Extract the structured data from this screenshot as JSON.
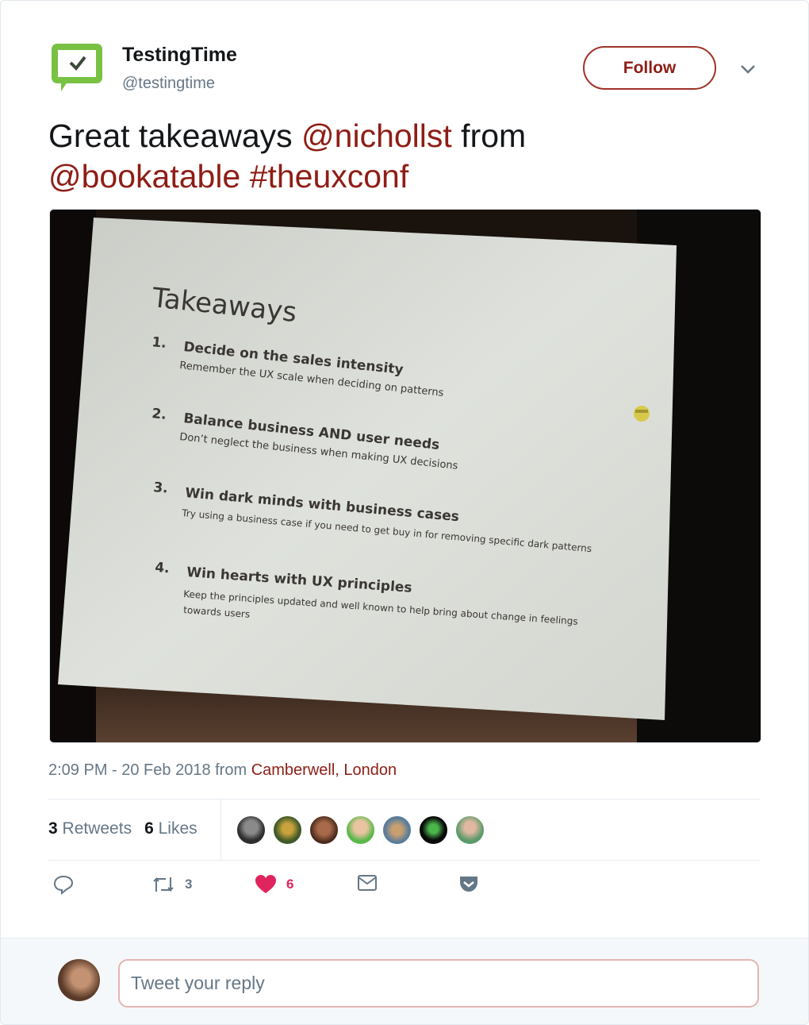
{
  "user": {
    "display_name": "TestingTime",
    "handle": "@testingtime",
    "follow_label": "Follow"
  },
  "tweet": {
    "text_prefix": "Great takeaways ",
    "mention1": "@nichollst",
    "text_mid": " from",
    "mention2": "@bookatable",
    "hashtag": "#theuxconf"
  },
  "slide": {
    "title": "Takeaways",
    "items": [
      {
        "num": "1.",
        "heading": "Decide on the sales intensity",
        "sub": "Remember the UX scale when deciding on patterns"
      },
      {
        "num": "2.",
        "heading": "Balance business AND user needs",
        "sub": "Don’t neglect the business when making UX decisions"
      },
      {
        "num": "3.",
        "heading": "Win dark minds with business cases",
        "sub": "Try using a business case if you need to get buy in for removing specific dark patterns"
      },
      {
        "num": "4.",
        "heading": "Win hearts with UX principles",
        "sub": "Keep the principles updated and well known to help bring about change in feelings",
        "sub2": "towards users"
      }
    ]
  },
  "meta": {
    "time_date": "2:09 PM - 20 Feb 2018 from ",
    "location": "Camberwell, London"
  },
  "stats": {
    "retweets_count": "3",
    "retweets_label": "Retweets",
    "likes_count": "6",
    "likes_label": "Likes"
  },
  "actions": {
    "retweet_count": "3",
    "like_count": "6"
  },
  "reply": {
    "placeholder": "Tweet your reply"
  },
  "colors": {
    "accent": "#8e1e16",
    "like": "#e0245e",
    "muted": "#657786",
    "logo_green": "#79c143"
  },
  "icons": [
    "testingtime-logo-icon",
    "chevron-down-icon",
    "reply-icon",
    "retweet-icon",
    "heart-icon",
    "message-icon",
    "pocket-icon"
  ]
}
